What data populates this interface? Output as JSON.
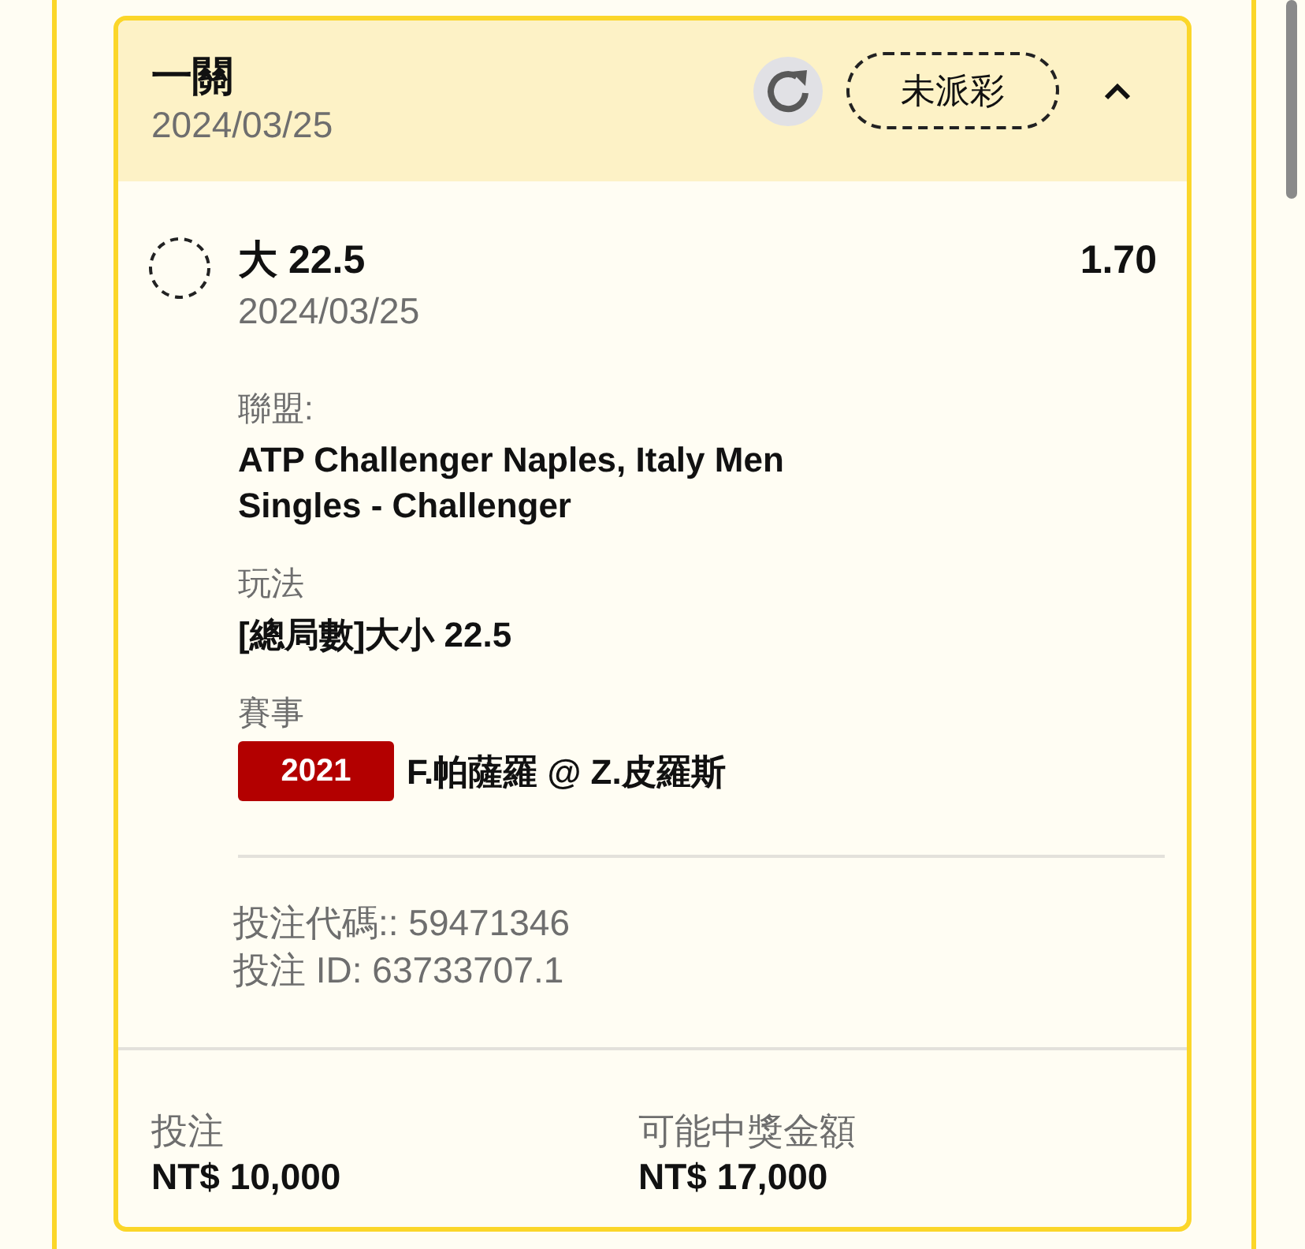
{
  "bet": {
    "title": "一關",
    "date": "2024/03/25",
    "status_badge": "未派彩",
    "expanded": true
  },
  "selection": {
    "name": "大 22.5",
    "date": "2024/03/25",
    "odds": "1.70",
    "settled": false
  },
  "details": [
    {
      "kind": "text",
      "label": "聯盟:",
      "value": "ATP Challenger Naples, Italy Men Singles - Challenger"
    },
    {
      "kind": "text",
      "label": "玩法",
      "value": "[總局數]大小 22.5"
    },
    {
      "kind": "match",
      "label": "賽事",
      "tag": "2021",
      "value": "F.帕薩羅 @ Z.皮羅斯"
    }
  ],
  "references": [
    "投注代碼:: 59471346",
    "投注 ID: 63733707.1"
  ],
  "summary": [
    {
      "label": "投注",
      "value": "NT$ 10,000"
    },
    {
      "label": "可能中獎金額",
      "value": "NT$ 17,000"
    }
  ]
}
